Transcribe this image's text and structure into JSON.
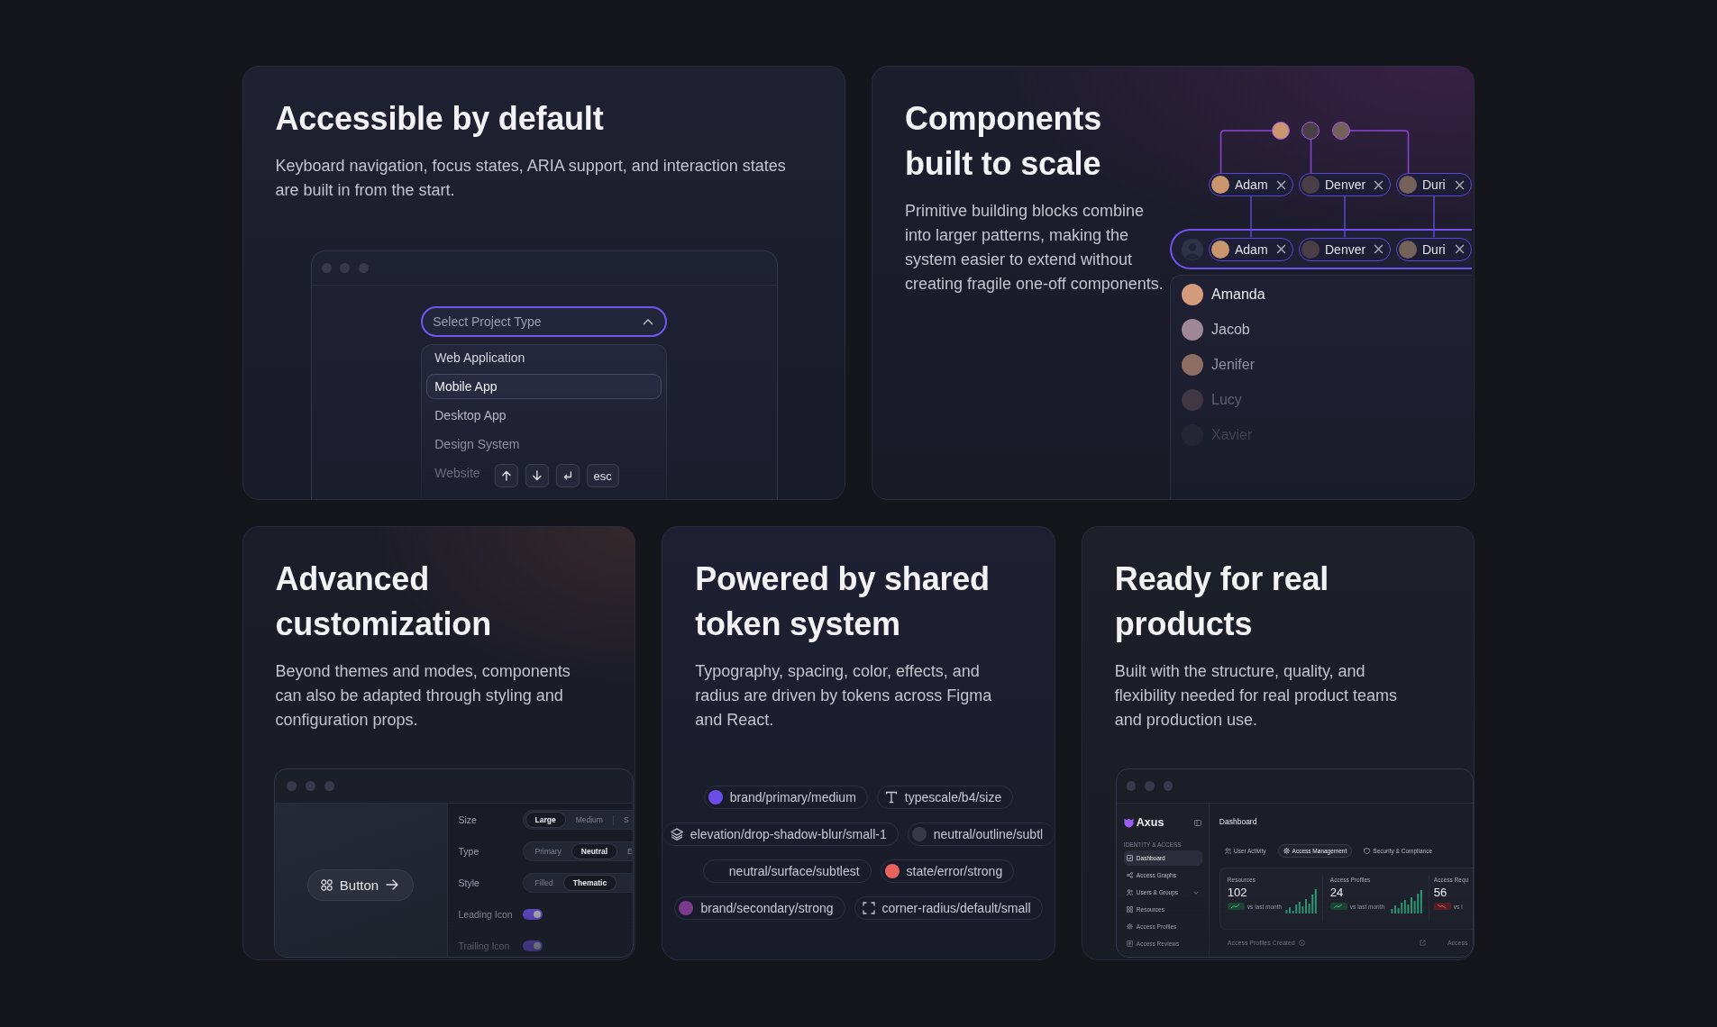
{
  "cards": [
    {
      "kind": "dropdown",
      "title": "Accessible by default",
      "description": "Keyboard navigation, focus states, ARIA support, and interaction states are built in from the start.",
      "select": {
        "placeholder": "Select Project Type",
        "expanded": true
      },
      "options": [
        {
          "label": "Web Application",
          "selected": false
        },
        {
          "label": "Mobile App",
          "selected": true
        },
        {
          "label": "Desktop App",
          "selected": false
        },
        {
          "label": "Design System",
          "selected": false
        },
        {
          "label": "Website",
          "selected": false
        }
      ],
      "keys": [
        {
          "kind": "up"
        },
        {
          "kind": "down"
        },
        {
          "kind": "enter"
        },
        {
          "kind": "text",
          "label": "esc"
        }
      ]
    },
    {
      "kind": "people",
      "title": "Components built to scale",
      "description": "Primitive building blocks combine into larger patterns, making the system easier to extend without creating fragile one-off components.",
      "chips": [
        {
          "name": "Adam"
        },
        {
          "name": "Denver"
        },
        {
          "name": "Duri"
        }
      ],
      "field_chips": [
        {
          "name": "Adam"
        },
        {
          "name": "Denver"
        },
        {
          "name": "Duri"
        }
      ],
      "suggestions": [
        {
          "name": "Amanda"
        },
        {
          "name": "Jacob"
        },
        {
          "name": "Jenifer"
        },
        {
          "name": "Lucy"
        },
        {
          "name": "Xavier"
        }
      ]
    },
    {
      "kind": "settings",
      "title": "Advanced customization",
      "description": "Beyond themes and modes, components can also be adapted through styling and configuration props.",
      "button": {
        "label": "Button"
      },
      "settings": [
        {
          "kind": "segmented",
          "label": "Size",
          "options": [
            {
              "label": "Large",
              "selected": true
            },
            {
              "label": "Medium",
              "selected": false
            },
            {
              "label": "S",
              "selected": false
            }
          ]
        },
        {
          "kind": "segmented",
          "label": "Type",
          "options": [
            {
              "label": "Primary",
              "selected": false
            },
            {
              "label": "Neutral",
              "selected": true
            },
            {
              "label": "E",
              "selected": false
            }
          ]
        },
        {
          "kind": "segmented",
          "label": "Style",
          "options": [
            {
              "label": "Filled",
              "selected": false
            },
            {
              "label": "Thematic",
              "selected": true
            }
          ]
        },
        {
          "kind": "toggle",
          "label": "Leading Icon",
          "on": true
        },
        {
          "kind": "toggle",
          "label": "Trailing Icon",
          "on": true
        }
      ]
    },
    {
      "kind": "tokens",
      "title": "Powered by shared token system",
      "description": "Typography, spacing, color, effects, and radius are driven by tokens across Figma and React.",
      "token_rows": [
        {
          "tokens": [
            {
              "kind": "color",
              "label": "brand/primary/medium",
              "color": "#6b4ee8"
            },
            {
              "kind": "type",
              "label": "typescale/b4/size"
            }
          ]
        },
        {
          "tokens": [
            {
              "kind": "effect",
              "label": "elevation/drop-shadow-blur/small-1"
            },
            {
              "kind": "color",
              "label": "neutral/outline/subtl",
              "color": "#363947"
            }
          ]
        },
        {
          "tokens": [
            {
              "kind": "plain",
              "label": "neutral/surface/subtlest"
            },
            {
              "kind": "color",
              "label": "state/error/strong",
              "color": "#ea625c"
            }
          ]
        },
        {
          "tokens": [
            {
              "kind": "color",
              "label": "brand/secondary/strong",
              "color": "#7a3b8a"
            },
            {
              "kind": "radius",
              "label": "corner-radius/default/small"
            }
          ]
        }
      ]
    },
    {
      "kind": "dashboard",
      "title": "Ready for real products",
      "description": "Built with the structure, quality, and flexibility needed for real product teams and production use.",
      "dashboard": {
        "brand": "Axus",
        "section_label": "IDENTITY & ACCESS",
        "nav": [
          {
            "kind": "link",
            "label": "Dashboard",
            "selected": true
          },
          {
            "kind": "link",
            "label": "Access Graphs",
            "selected": false
          },
          {
            "kind": "group",
            "label": "Users & Groups",
            "selected": false
          },
          {
            "kind": "link",
            "label": "Resources",
            "selected": false
          },
          {
            "kind": "link",
            "label": "Access Profiles",
            "selected": false
          },
          {
            "kind": "link",
            "label": "Access Reviews",
            "selected": false
          }
        ],
        "page_title": "Dashboard",
        "tabs": [
          {
            "label": "User Activity",
            "selected": false
          },
          {
            "label": "Access Management",
            "selected": true
          },
          {
            "label": "Security & Compliance",
            "selected": false
          }
        ],
        "stats": [
          {
            "kind": "up",
            "label": "Resources",
            "value": "102",
            "note": "vs last month"
          },
          {
            "kind": "up",
            "label": "Access Profiles",
            "value": "24",
            "note": "vs last month"
          },
          {
            "kind": "down",
            "label": "Access Requ",
            "value": "56",
            "note": "vs l"
          }
        ],
        "footer": [
          {
            "label": "Access Profiles Created"
          },
          {
            "label": "Access"
          }
        ]
      }
    }
  ]
}
